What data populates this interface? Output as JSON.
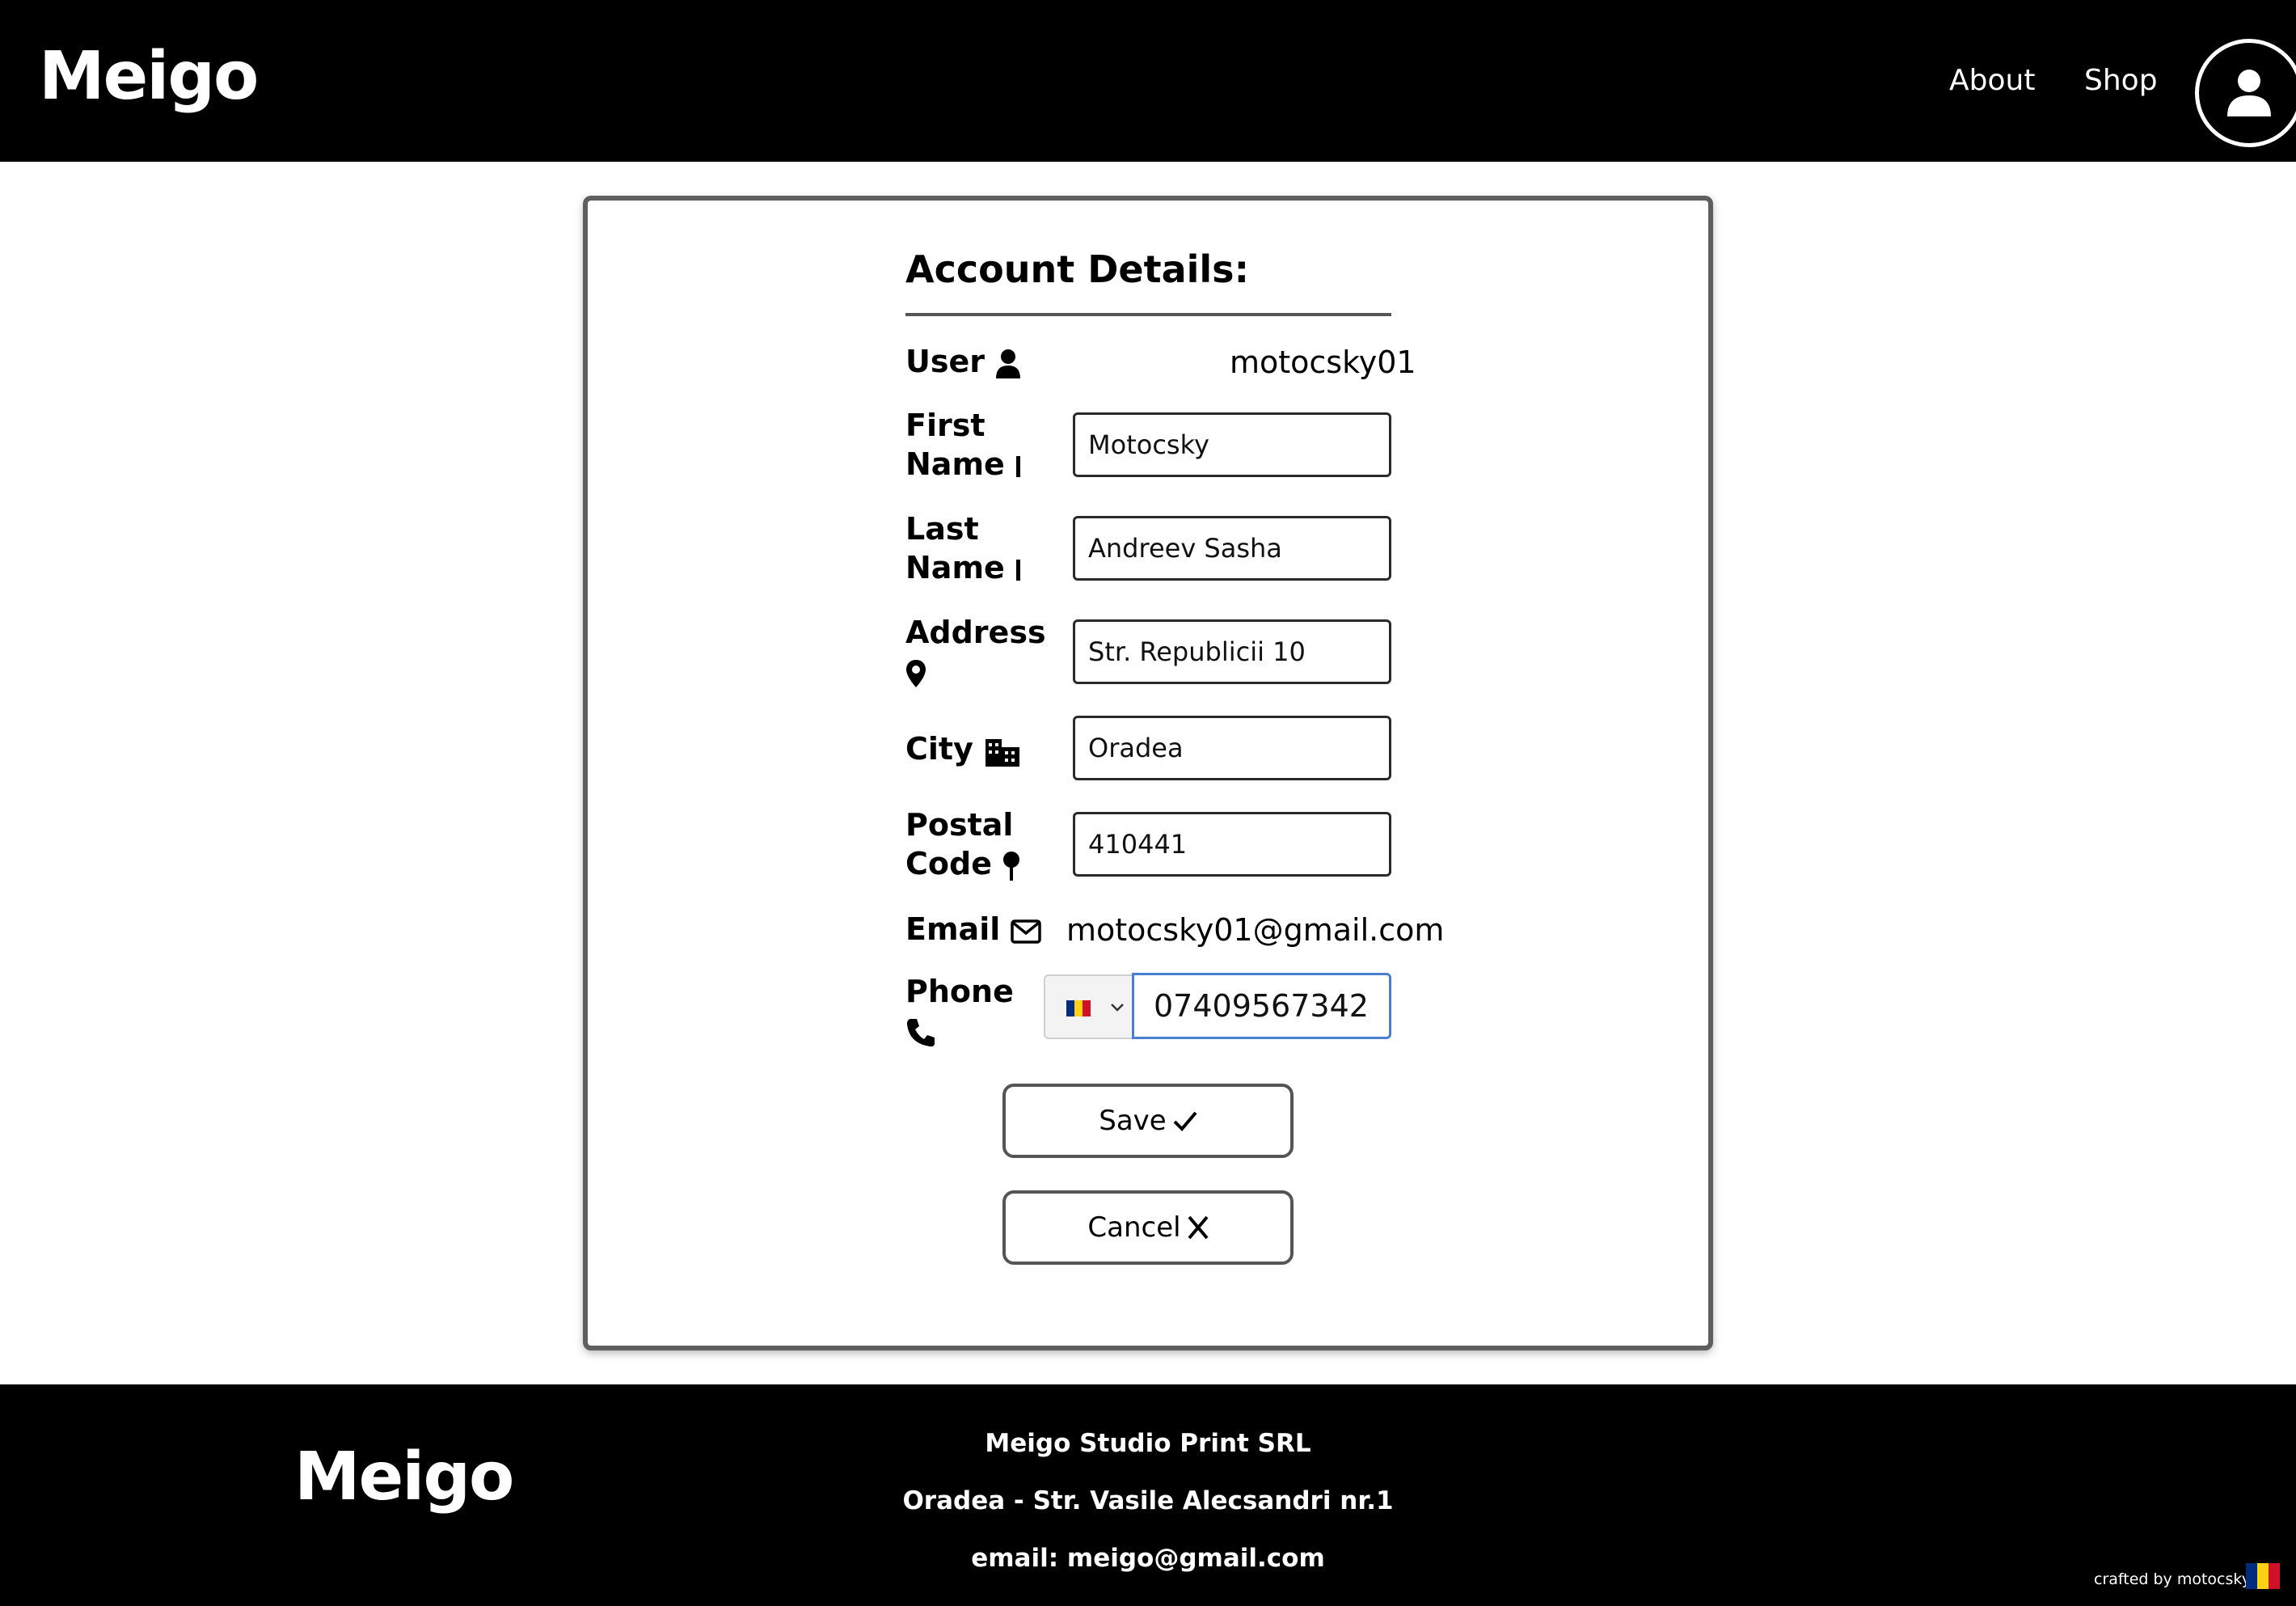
{
  "header": {
    "logo": "Meigo",
    "nav": [
      {
        "label": "About"
      },
      {
        "label": "Shop"
      }
    ],
    "account_icon": "user-circle-icon"
  },
  "form": {
    "title": "Account Details:",
    "user": {
      "label": "User",
      "icon": "user-icon",
      "value": "motocsky01"
    },
    "first_name": {
      "label_line1": "First",
      "label_line2": "Name",
      "icon": "id-card-icon",
      "value": "Motocsky"
    },
    "last_name": {
      "label_line1": "Last",
      "label_line2": "Name",
      "icon": "id-card-icon",
      "value": "Andreev Sasha"
    },
    "address": {
      "label": "Address",
      "icon": "map-pin-icon",
      "value": "Str. Republicii 10"
    },
    "city": {
      "label": "City",
      "icon": "city-icon",
      "value": "Oradea"
    },
    "postal_code": {
      "label_line1": "Postal",
      "label_line2": "Code",
      "icon": "map-pin-small-icon",
      "value": "410441"
    },
    "email": {
      "label": "Email",
      "icon": "envelope-icon",
      "value": "motocsky01@gmail.com"
    },
    "phone": {
      "label": "Phone",
      "icon": "phone-icon",
      "country_flag": "flag-romania-icon",
      "value": "07409567342"
    },
    "save_label": "Save",
    "cancel_label": "Cancel"
  },
  "footer": {
    "logo": "Meigo",
    "company": "Meigo Studio Print SRL",
    "address": "Oradea - Str. Vasile Alecsandri nr.1",
    "email": "email: meigo@gmail.com",
    "credit": "crafted by motocsky"
  },
  "colors": {
    "header_bg": "#000000",
    "footer_bg": "#000000",
    "card_border": "#5f5f5f",
    "phone_focus": "#4a7fd0",
    "flag_blue": "#002b7f",
    "flag_yellow": "#fcd116",
    "flag_red": "#ce1126"
  }
}
